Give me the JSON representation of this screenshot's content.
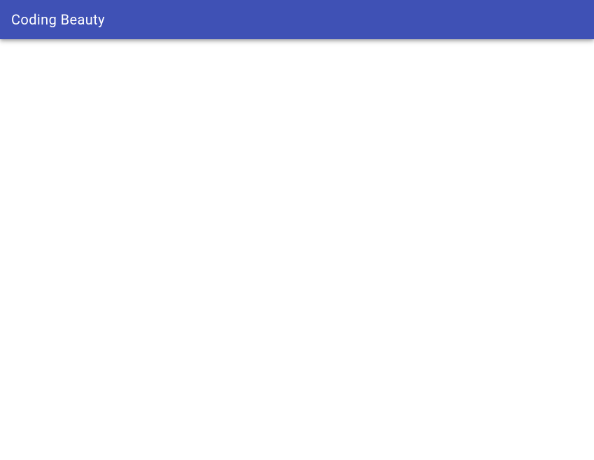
{
  "header": {
    "title": "Coding Beauty"
  }
}
